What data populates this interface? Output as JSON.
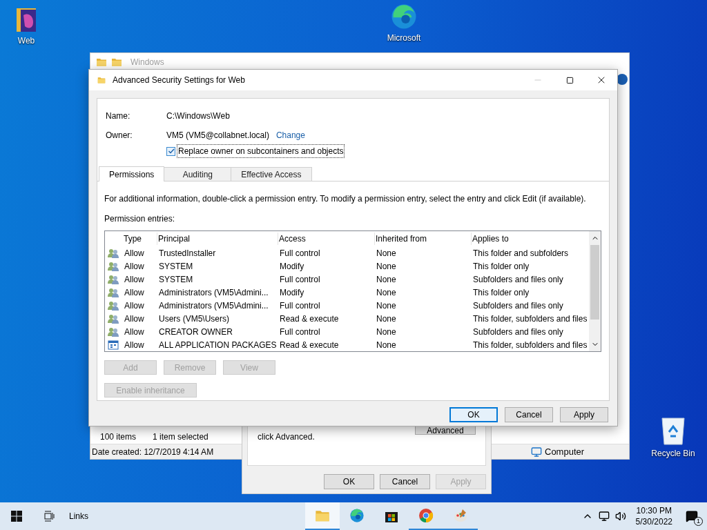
{
  "desktop_icons": [
    {
      "label": "Web",
      "kind": "folder"
    },
    {
      "label": "Microsoft",
      "kind": "edge"
    },
    {
      "label": "Recycle Bin",
      "kind": "bin"
    }
  ],
  "explorer": {
    "title": "Windows",
    "item_count": "100 items",
    "selection": "1 item selected",
    "details": "Date created: 12/7/2019 4:14 AM",
    "location": "Computer"
  },
  "properties": {
    "hint": "click Advanced.",
    "advanced_button": "Advanced",
    "buttons": [
      {
        "label": "OK",
        "disabled": false
      },
      {
        "label": "Cancel",
        "disabled": false
      },
      {
        "label": "Apply",
        "disabled": true
      }
    ]
  },
  "dialog": {
    "title": "Advanced Security Settings for Web",
    "name_label": "Name:",
    "name": "C:\\Windows\\Web",
    "owner_label": "Owner:",
    "owner": "VM5 (VM5@collabnet.local)",
    "change_link": "Change",
    "replace_owner": {
      "label": "Replace owner on subcontainers and objects",
      "checked": true
    },
    "tabs": [
      {
        "label": "Permissions",
        "selected": true
      },
      {
        "label": "Auditing",
        "selected": false
      },
      {
        "label": "Effective Access",
        "selected": false
      }
    ],
    "info": "For additional information, double-click a permission entry. To modify a permission entry, select the entry and click Edit (if available).",
    "entries_label": "Permission entries:",
    "table": {
      "columns": [
        "Type",
        "Principal",
        "Access",
        "Inherited from",
        "Applies to"
      ],
      "rows": [
        {
          "kind": "user",
          "cells": [
            "Allow",
            "TrustedInstaller",
            "Full control",
            "None",
            "This folder and subfolders"
          ]
        },
        {
          "kind": "user",
          "cells": [
            "Allow",
            "SYSTEM",
            "Modify",
            "None",
            "This folder only"
          ]
        },
        {
          "kind": "user",
          "cells": [
            "Allow",
            "SYSTEM",
            "Full control",
            "None",
            "Subfolders and files only"
          ]
        },
        {
          "kind": "user",
          "cells": [
            "Allow",
            "Administrators (VM5\\Admini...",
            "Modify",
            "None",
            "This folder only"
          ]
        },
        {
          "kind": "user",
          "cells": [
            "Allow",
            "Administrators (VM5\\Admini...",
            "Full control",
            "None",
            "Subfolders and files only"
          ]
        },
        {
          "kind": "user",
          "cells": [
            "Allow",
            "Users (VM5\\Users)",
            "Read & execute",
            "None",
            "This folder, subfolders and files"
          ]
        },
        {
          "kind": "user",
          "cells": [
            "Allow",
            "CREATOR OWNER",
            "Full control",
            "None",
            "Subfolders and files only"
          ]
        },
        {
          "kind": "package",
          "cells": [
            "Allow",
            "ALL APPLICATION PACKAGES",
            "Read & execute",
            "None",
            "This folder, subfolders and files"
          ]
        }
      ]
    },
    "actions": [
      {
        "label": "Add",
        "disabled": true
      },
      {
        "label": "Remove",
        "disabled": true
      },
      {
        "label": "View",
        "disabled": true
      }
    ],
    "inheritance_button": {
      "label": "Enable inheritance",
      "disabled": true
    },
    "buttons": [
      {
        "label": "OK",
        "default": true
      },
      {
        "label": "Cancel",
        "default": false
      },
      {
        "label": "Apply",
        "default": false
      }
    ]
  },
  "taskbar": {
    "search": "Links",
    "apps": [
      {
        "kind": "explorer",
        "selected": true,
        "running": true
      },
      {
        "kind": "edge",
        "selected": false,
        "running": false
      },
      {
        "kind": "store",
        "selected": false,
        "running": false
      },
      {
        "kind": "chrome",
        "selected": false,
        "running": true
      },
      {
        "kind": "paint",
        "selected": false,
        "running": true
      }
    ],
    "time": "10:30 PM",
    "date": "5/30/2022",
    "notifications": "1"
  }
}
